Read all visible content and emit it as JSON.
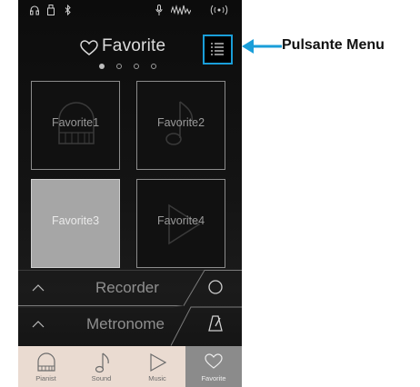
{
  "header": {
    "title": "Favorite"
  },
  "pager": {
    "count": 4,
    "active_index": 0
  },
  "favorites": [
    {
      "label": "Favorite1",
      "icon": "piano-icon",
      "selected": false
    },
    {
      "label": "Favorite2",
      "icon": "music-note-icon",
      "selected": false
    },
    {
      "label": "Favorite3",
      "icon": "none",
      "selected": true
    },
    {
      "label": "Favorite4",
      "icon": "play-icon",
      "selected": false
    }
  ],
  "bars": {
    "recorder": {
      "label": "Recorder",
      "action_icon": "record-icon"
    },
    "metronome": {
      "label": "Metronome",
      "action_icon": "metronome-icon"
    }
  },
  "tabs": [
    {
      "label": "Pianist",
      "icon": "piano-icon",
      "active": false
    },
    {
      "label": "Sound",
      "icon": "music-note-icon",
      "active": false
    },
    {
      "label": "Music",
      "icon": "play-icon",
      "active": false
    },
    {
      "label": "Favorite",
      "icon": "heart-icon",
      "active": true
    }
  ],
  "callout": {
    "text": "Pulsante Menu"
  },
  "colors": {
    "accent": "#1a9ed9",
    "tabbar": "#eadbd1",
    "selected_tile": "#a6a6a6"
  }
}
